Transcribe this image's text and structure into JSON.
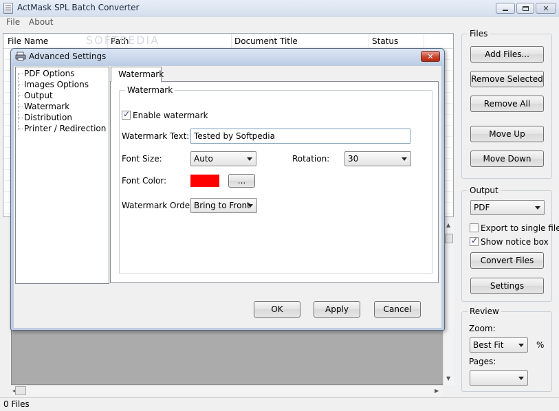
{
  "window": {
    "title": "ActMask SPL Batch Converter"
  },
  "menu": [
    "File",
    "About"
  ],
  "file_list": {
    "columns": [
      "File Name",
      "Path",
      "Document Title",
      "Status"
    ],
    "watermark_text": "SOFTPEDIA"
  },
  "files_group": {
    "title": "Files",
    "buttons": [
      "Add Files...",
      "Remove Selected",
      "Remove All",
      "Move Up",
      "Move Down"
    ]
  },
  "output_group": {
    "title": "Output",
    "format": "PDF",
    "export_single": {
      "label": "Export to single file",
      "checked": false
    },
    "show_notice": {
      "label": "Show notice box",
      "checked": true
    },
    "convert_label": "Convert Files",
    "settings_label": "Settings"
  },
  "review_group": {
    "title": "Review",
    "zoom_label": "Zoom:",
    "zoom_value": "Best Fit",
    "zoom_unit": "%",
    "pages_label": "Pages:",
    "pages_value": ""
  },
  "status": "0 Files",
  "dialog": {
    "title": "Advanced Settings",
    "tree": [
      "PDF Options",
      "Images Options",
      "Output",
      "Watermark",
      "Distribution",
      "Printer / Redirection"
    ],
    "active_tab": "Watermark",
    "group_title": "Watermark",
    "enable": {
      "label": "Enable watermark",
      "checked": true
    },
    "text_label": "Watermark Text:",
    "text_value": "Tested by Softpedia",
    "font_size_label": "Font Size:",
    "font_size_value": "Auto",
    "rotation_label": "Rotation:",
    "rotation_value": "30",
    "font_color_label": "Font Color:",
    "font_color": "#ff0000",
    "color_picker_label": "...",
    "order_label": "Watermark Order:",
    "order_value": "Bring to Front",
    "ok": "OK",
    "apply": "Apply",
    "cancel": "Cancel"
  },
  "colors": {
    "dialog_frame": "#bfcde0",
    "close_button": "#c8442e",
    "swatch": "#ff0000"
  }
}
